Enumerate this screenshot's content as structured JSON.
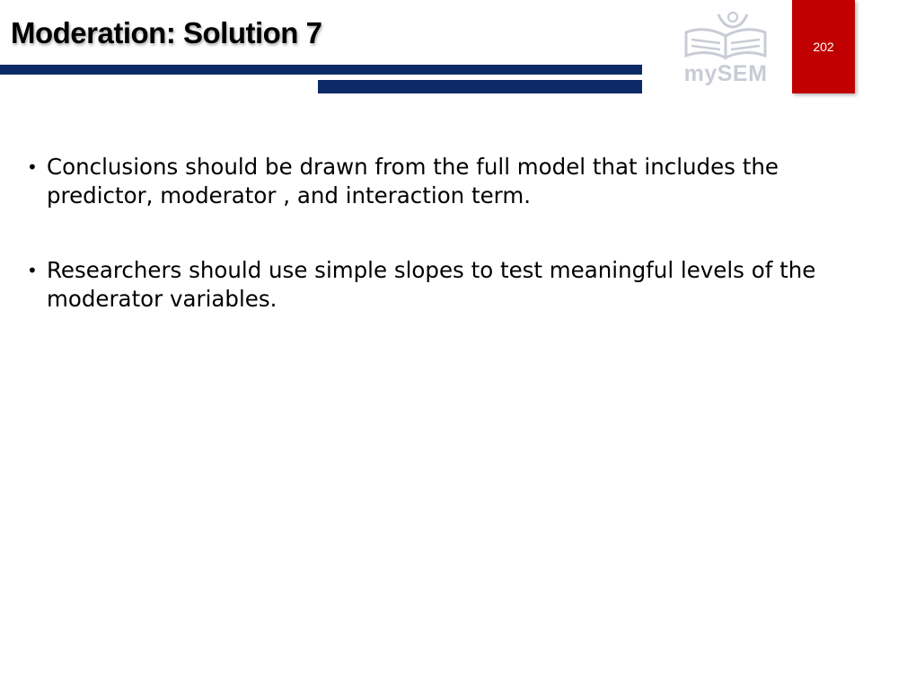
{
  "slide": {
    "title": "Moderation: Solution 7",
    "page_number": "202",
    "logo_text": "mySEM",
    "bullets": [
      {
        "text": "Conclusions should be drawn from the full model that includes the predictor, moderator , and interaction term."
      },
      {
        "text": "Researchers should use simple slopes to test meaningful levels of the moderator variables."
      }
    ]
  },
  "colors": {
    "accent_bar": "#0b2a66",
    "page_tab": "#c00000",
    "logo": "#c9ccd6"
  },
  "icons": {
    "bullet": "bullet-icon",
    "logo": "mysem-logo-icon"
  }
}
